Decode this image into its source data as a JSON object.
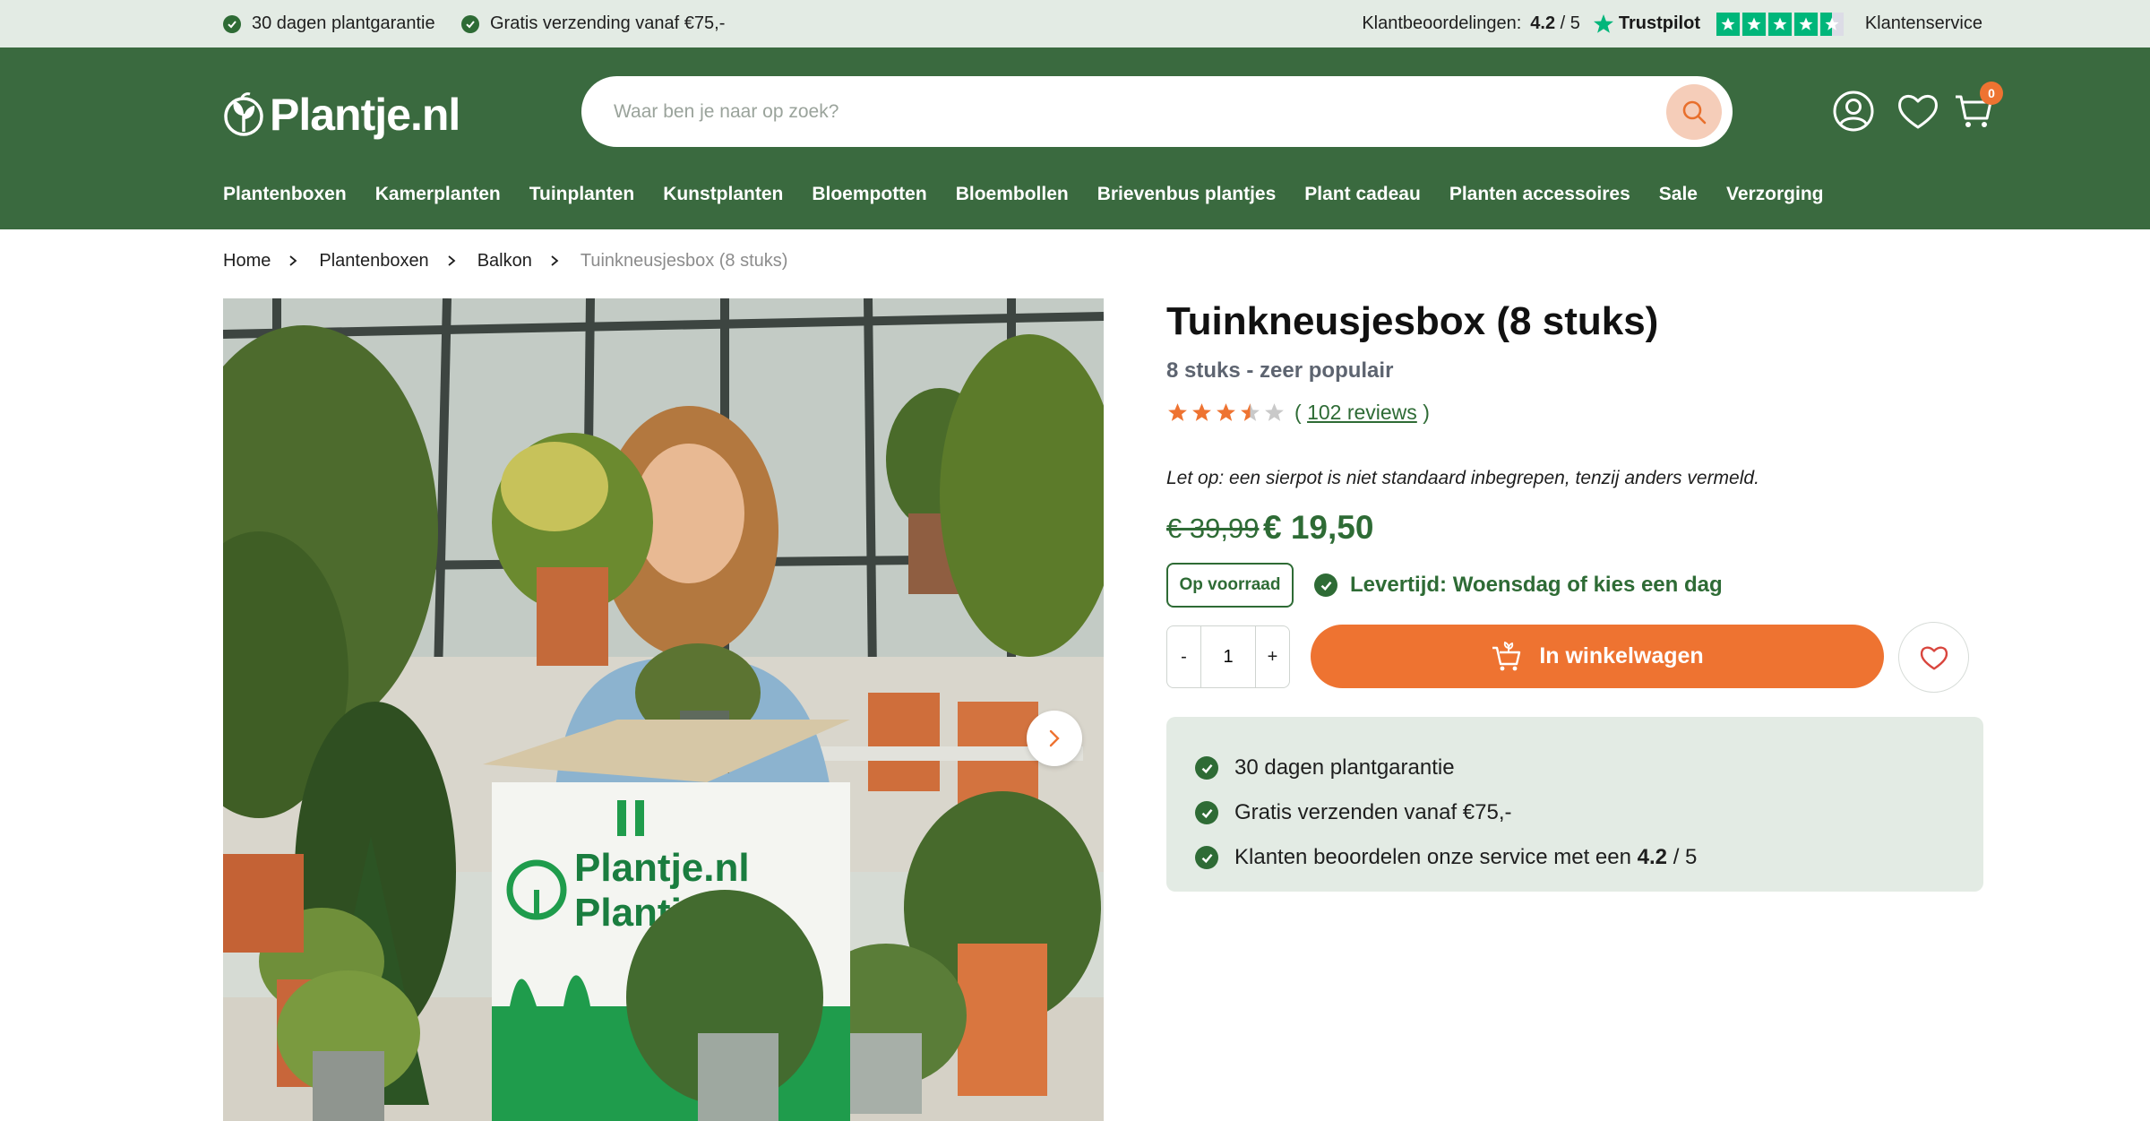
{
  "topbar": {
    "usps": [
      "30 dagen plantgarantie",
      "Gratis verzending vanaf €75,-"
    ],
    "rating_label": "Klantbeoordelingen:",
    "rating_value": "4.2",
    "rating_scale": "/ 5",
    "trustpilot": "Trustpilot",
    "trustpilot_stars": 4.2,
    "customer_service": "Klantenservice"
  },
  "header": {
    "logo_text": "Plantje.nl",
    "search_placeholder": "Waar ben je naar op zoek?",
    "cart_count": "0",
    "icons": [
      "search-icon",
      "account-icon",
      "heart-icon",
      "cart-icon"
    ]
  },
  "nav": {
    "items": [
      "Plantenboxen",
      "Kamerplanten",
      "Tuinplanten",
      "Kunstplanten",
      "Bloempotten",
      "Bloembollen",
      "Brievenbus plantjes",
      "Plant cadeau",
      "Planten accessoires",
      "Sale",
      "Verzorging"
    ]
  },
  "breadcrumb": {
    "items": [
      "Home",
      "Plantenboxen",
      "Balkon"
    ],
    "current": "Tuinkneusjesbox (8 stuks)"
  },
  "gallery": {
    "box_text_1": "Plantje.nl",
    "box_text_2": "Plantje.be"
  },
  "product": {
    "title": "Tuinkneusjesbox (8 stuks)",
    "subtitle": "8 stuks - zeer populair",
    "rating": 3.5,
    "reviews_open": "(",
    "reviews_text": "102 reviews",
    "reviews_close": ")",
    "note": "Let op: een sierpot is niet standaard inbegrepen, tenzij anders vermeld.",
    "old_price": "€ 39,99",
    "new_price": "€ 19,50",
    "stock": "Op voorraad",
    "delivery": "Levertijd: Woensdag of kies een dag",
    "qty_minus": "-",
    "qty_value": "1",
    "qty_plus": "+",
    "add_to_cart": "In winkelwagen"
  },
  "usp_box": {
    "line1": "30 dagen plantgarantie",
    "line2": "Gratis verzenden vanaf €75,-",
    "line3_prefix": "Klanten beoordelen onze service met een",
    "line3_value": "4.2",
    "line3_suffix": "/ 5"
  },
  "colors": {
    "brand_green": "#3a6a3f",
    "accent_orange": "#ee7331",
    "light_green": "#e3ebe4",
    "trustpilot_green": "#00b67a"
  }
}
